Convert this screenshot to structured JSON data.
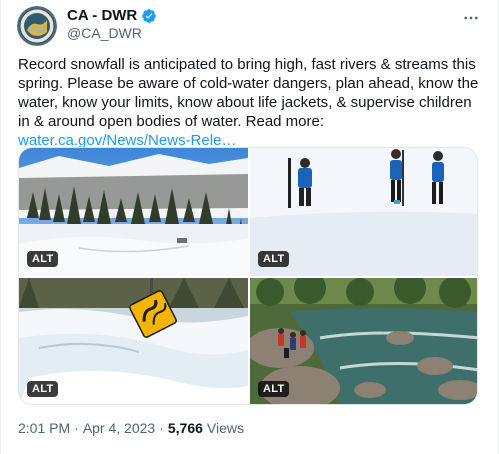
{
  "author": {
    "display_name": "CA - DWR",
    "handle": "@CA_DWR",
    "verified": true,
    "avatar_icon": "dwr-seal-logo"
  },
  "tweet": {
    "text": "Record snowfall is anticipated to bring high, fast rivers & streams this spring. Please be aware of cold-water dangers, plan ahead, know the water, know your limits, know about life jackets, & supervise children in & around open bodies of water. Read more: ",
    "link_text": "water.ca.gov/News/News-Rele…"
  },
  "media": [
    {
      "alt_label": "ALT",
      "depicts": "snowy-forest-landscape"
    },
    {
      "alt_label": "ALT",
      "depicts": "snow-survey-team"
    },
    {
      "alt_label": "ALT",
      "depicts": "snow-covered-curve-sign"
    },
    {
      "alt_label": "ALT",
      "depicts": "people-by-river"
    }
  ],
  "meta": {
    "time": "2:01 PM",
    "separator": "·",
    "date": "Apr 4, 2023",
    "views_count": "5,766",
    "views_label": "Views"
  },
  "colors": {
    "link": "#1d9bf0",
    "verified": "#1d9bf0",
    "secondary_text": "#536471"
  }
}
